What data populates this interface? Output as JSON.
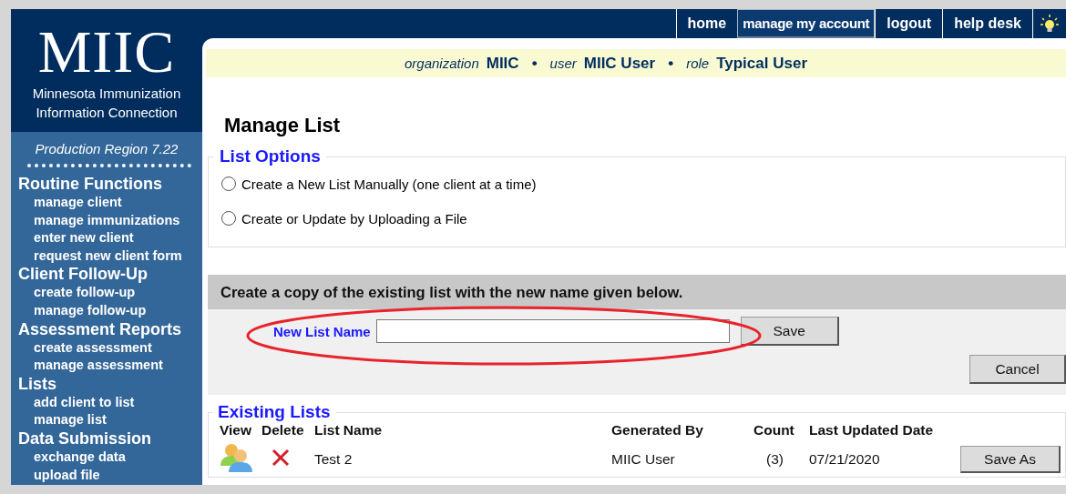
{
  "logo": {
    "title": "MIIC",
    "subtitle": "Minnesota Immunization Information Connection"
  },
  "sidebar": {
    "region": "Production Region 7.22",
    "sections": [
      {
        "heading": "Routine Functions",
        "items": [
          "manage client",
          "manage immunizations",
          "enter new client",
          "request new client form"
        ]
      },
      {
        "heading": "Client Follow-Up",
        "items": [
          "create follow-up",
          "manage follow-up"
        ]
      },
      {
        "heading": "Assessment Reports",
        "items": [
          "create assessment",
          "manage assessment"
        ]
      },
      {
        "heading": "Lists",
        "items": [
          "add client to list",
          "manage list"
        ]
      },
      {
        "heading": "Data Submission",
        "items": [
          "exchange data",
          "upload file"
        ]
      }
    ]
  },
  "top_nav": [
    {
      "label": "home",
      "selected": false
    },
    {
      "label": "manage my account",
      "selected": true
    },
    {
      "label": "logout",
      "selected": false
    },
    {
      "label": "help desk",
      "selected": false
    }
  ],
  "context_bar": {
    "separator": "•",
    "items": [
      {
        "label": "organization",
        "value": "MIIC"
      },
      {
        "label": "user",
        "value": "MIIC User"
      },
      {
        "label": "role",
        "value": "Typical User"
      }
    ]
  },
  "page_title": "Manage List",
  "list_options": {
    "legend": "List Options",
    "options": [
      {
        "label": "Create a New List Manually (one client at a time)",
        "selected": false
      },
      {
        "label": "Create or Update by Uploading a File",
        "selected": false
      }
    ]
  },
  "copy_panel": {
    "header": "Create a copy of the existing list with the new name given below.",
    "field_label": "New List Name",
    "save": "Save",
    "cancel": "Cancel",
    "highlighted": true
  },
  "existing_lists": {
    "legend": "Existing Lists",
    "columns": [
      "View",
      "Delete",
      "List Name",
      "Generated By",
      "Count",
      "Last Updated Date"
    ],
    "rows": [
      {
        "list_name": "Test 2",
        "generated_by": "MIIC User",
        "count": "(3)",
        "last_updated": "07/21/2020",
        "action": "Save As"
      }
    ]
  }
}
